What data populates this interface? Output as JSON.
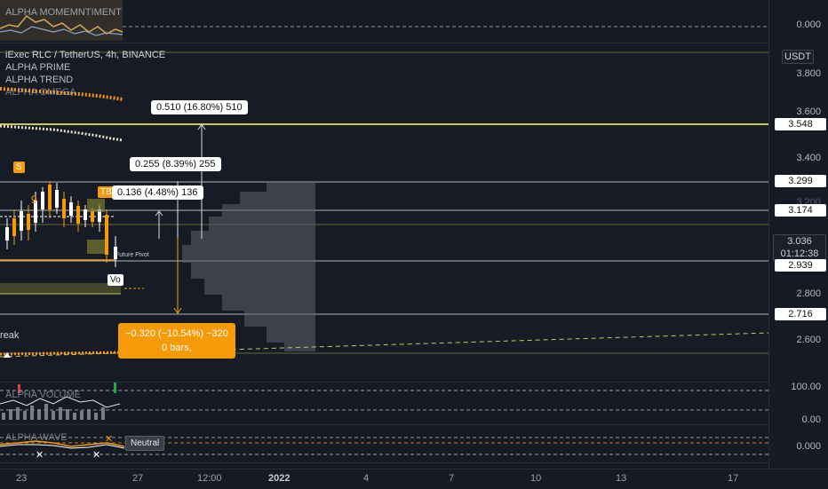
{
  "top_indicator": {
    "title": "ALPHA MOMEMNTIMENT",
    "level": "0.000"
  },
  "main": {
    "symbol_line": "iExec RLC / TetherUS, 4h, BINANCE",
    "indicators": [
      "ALPHA PRIME",
      "ALPHA TREND",
      "ALPHA OMEGA"
    ],
    "currency": "USDT",
    "price_levels": [
      "3.800",
      "3.600",
      "3.400",
      "3.200",
      "2.800",
      "2.600"
    ],
    "tags": {
      "level_3548": "3.548",
      "level_3299": "3.299",
      "level_3174": "3.174",
      "current_price": "3.036",
      "countdown": "01:12:38",
      "level_2939": "2.939",
      "level_2716": "2.716"
    },
    "measure_boxes": {
      "m1": "0.510 (16.80%) 510",
      "m2": "0.255 (8.39%) 255",
      "m3": "0.136 (4.48%) 136",
      "down_line1": "−0.320 (−10.54%) −320",
      "down_line2": "0 bars,"
    },
    "labels": {
      "s_signal": "S",
      "tb_signal": "TB",
      "nine": "9",
      "vo": "Vo",
      "future_pivot": "Future Pivot",
      "break": "reak"
    }
  },
  "volume_indicator": {
    "title": "ALPHA VOLUME",
    "levels": [
      "100.00",
      "0.00"
    ]
  },
  "wave_indicator": {
    "title": "ALPHA WAVE",
    "status": "Neutral",
    "level": "0.000"
  },
  "time_axis": [
    "23",
    "27",
    "12:00",
    "2022",
    "4",
    "7",
    "10",
    "13",
    "17"
  ],
  "colors": {
    "background": "#161a25",
    "accent_orange": "#f59b0a",
    "level_yellow": "#c8c85a",
    "trend_orange": "#f7931a"
  }
}
